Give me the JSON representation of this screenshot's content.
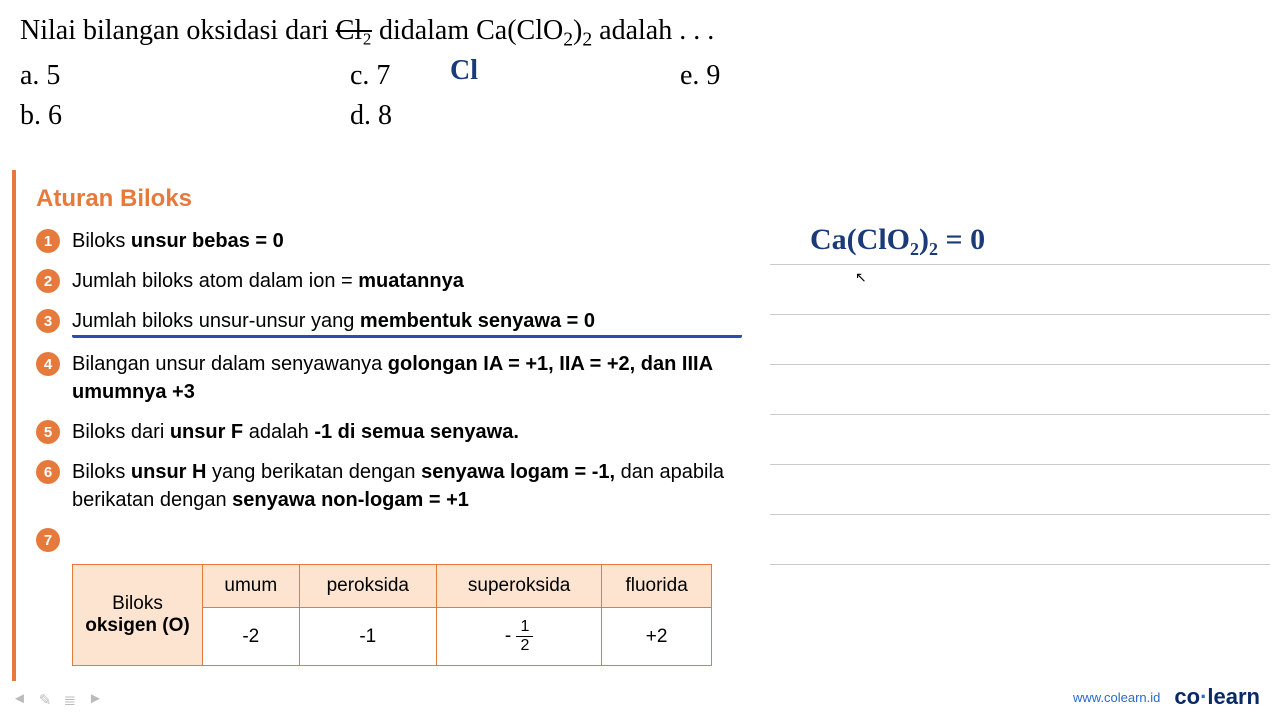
{
  "question": {
    "prefix": "Nilai bilangan oksidasi dari ",
    "strike": "Cl₂",
    "middle": " didalam Ca(ClO",
    "sub1": "2",
    "after1": ")",
    "sub2": "2",
    "suffix": " adalah . . ."
  },
  "handwritten_cl": "Cl",
  "options": {
    "a": "a.   5",
    "b": "b.   6",
    "c": "c.   7",
    "d": "d.   8",
    "e": "e.   9"
  },
  "rules": {
    "title": "Aturan Biloks",
    "items": [
      {
        "n": "1",
        "html": "Biloks <b>unsur bebas = 0</b>"
      },
      {
        "n": "2",
        "html": "Jumlah biloks atom dalam ion = <b>muatannya</b>"
      },
      {
        "n": "3",
        "html": "Jumlah biloks unsur-unsur yang <b>membentuk senyawa = 0</b>",
        "underline": true
      },
      {
        "n": "4",
        "html": "Bilangan unsur dalam senyawanya <b>golongan IA = +1, IIA = +2, dan IIIA umumnya +3</b>"
      },
      {
        "n": "5",
        "html": "Biloks dari <b>unsur F</b> adalah <b>-1 di semua senyawa.</b>"
      },
      {
        "n": "6",
        "html": "Biloks <b>unsur H</b> yang berikatan dengan <b>senyawa logam = -1,</b> dan apabila berikatan dengan <b>senyawa non-logam = +1</b>"
      }
    ]
  },
  "chart_data": {
    "type": "table",
    "title": "Biloks oksigen (O)",
    "row_label_line1": "Biloks",
    "row_label_line2": "oksigen (O)",
    "columns": [
      "umum",
      "peroksida",
      "superoksida",
      "fluorida"
    ],
    "values": [
      "-2",
      "-1",
      "-1/2",
      "+2"
    ]
  },
  "equation": "Ca(ClO₂)₂ = 0",
  "footer": {
    "link": "www.colearn.id",
    "logo_co": "co",
    "logo_dot": "·",
    "logo_learn": "learn"
  },
  "controls": {
    "back": "◄",
    "pen": "✎",
    "list": "≣",
    "fwd": "►"
  }
}
